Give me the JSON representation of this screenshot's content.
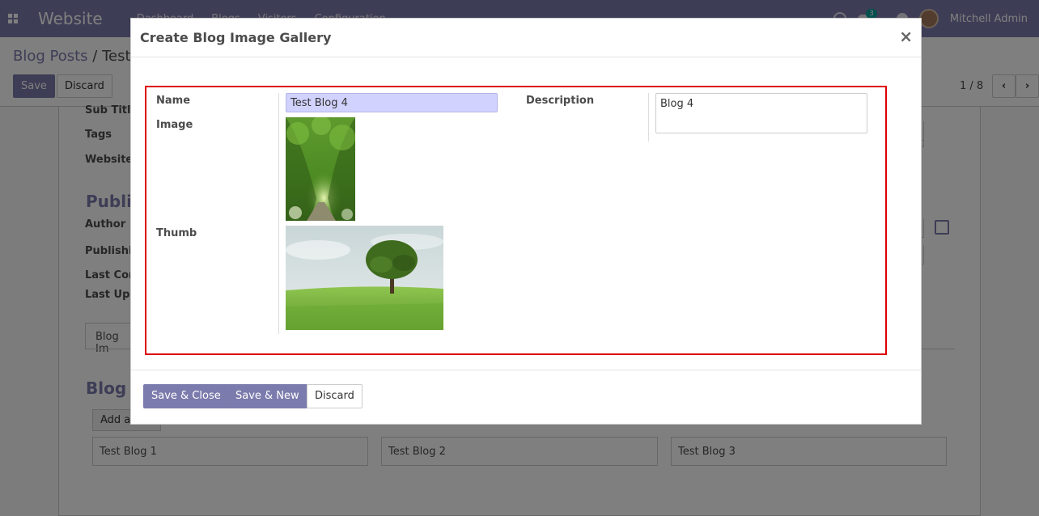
{
  "navbar": {
    "brand": "Website",
    "menu": [
      "Dashboard",
      "Blogs",
      "Visitors",
      "Configuration"
    ],
    "chat_count": "3",
    "user_name": "Mitchell Admin"
  },
  "control": {
    "breadcrumb_parent": "Blog Posts",
    "breadcrumb_sep": "/",
    "breadcrumb_current": "Test B",
    "save_label": "Save",
    "discard_label": "Discard",
    "pager_value": "1 / 8",
    "pager_prev": "‹",
    "pager_next": "›"
  },
  "sheet": {
    "sub_title_label": "Sub Title",
    "tags_label": "Tags",
    "website_label": "Website",
    "publishing_heading": "Publis",
    "author_label": "Author",
    "publishing_date_label": "Publishin",
    "last_contributor_label": "Last Con",
    "last_updated_label": "Last Upd",
    "tab_label": "Blog Im",
    "gallery_heading": "Blog I",
    "add_line_label": "Add a line",
    "cards": [
      "Test Blog 1",
      "Test Blog 2",
      "Test Blog 3"
    ]
  },
  "modal": {
    "title": "Create Blog Image Gallery",
    "close": "×",
    "name_label": "Name",
    "name_value": "Test Blog 4",
    "image_label": "Image",
    "thumb_label": "Thumb",
    "description_label": "Description",
    "description_value": "Blog 4",
    "save_close_label": "Save & Close",
    "save_new_label": "Save & New",
    "discard_label": "Discard"
  },
  "colors": {
    "brand": "#7c7bad",
    "highlight": "#dd0000",
    "input_bg": "#d2d2ff"
  }
}
